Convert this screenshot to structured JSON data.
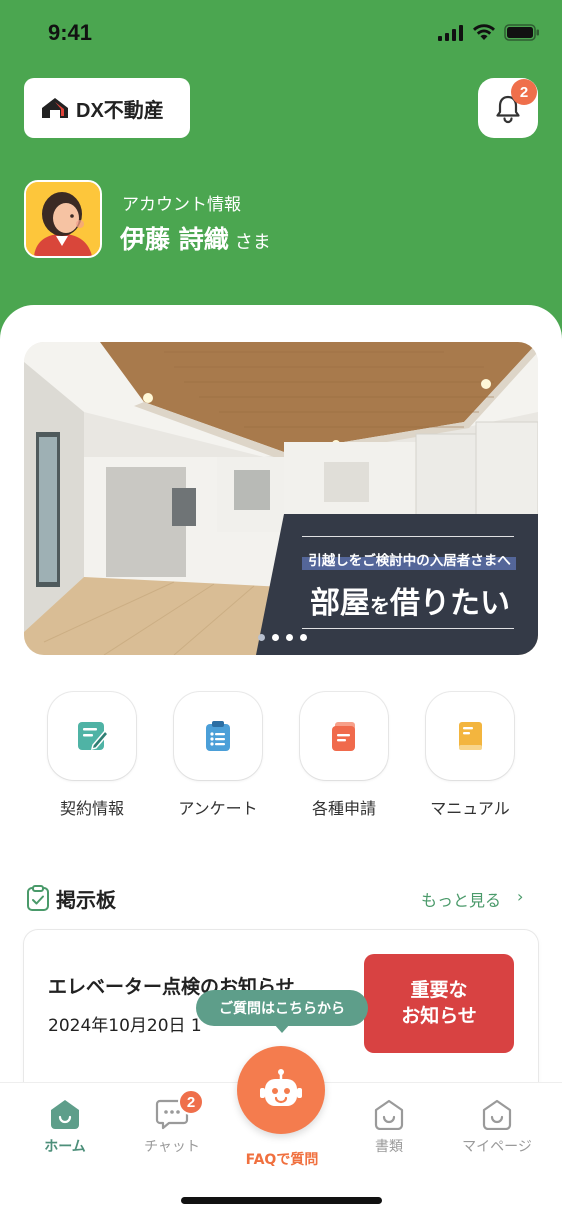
{
  "status_bar": {
    "time": "9:41"
  },
  "header": {
    "logo_text": "DX不動産",
    "notification_count": "2",
    "account_label": "アカウント情報",
    "account_name": "伊藤 詩織",
    "account_suffix": "さま"
  },
  "banner": {
    "subtitle": "引越しをご検討中の入居者さまへ",
    "title_part1": "部屋",
    "title_part2": "を",
    "title_part3": "借りたい",
    "slide_count": 4,
    "active_slide_index": 0
  },
  "menu": [
    {
      "label": "契約情報",
      "icon": "contract-icon",
      "color": "#4fb3a5"
    },
    {
      "label": "アンケート",
      "icon": "clipboard-icon",
      "color": "#4b9fd8"
    },
    {
      "label": "各種申請",
      "icon": "form-icon",
      "color": "#f06a4c"
    },
    {
      "label": "マニュアル",
      "icon": "book-icon",
      "color": "#f3b53e"
    }
  ],
  "bulletin": {
    "title": "掲示板",
    "more_label": "もっと見る",
    "post_title": "エレベーター点検のお知らせ",
    "post_date": "2024年10月20日 1",
    "important_line1": "重要な",
    "important_line2": "お知らせ"
  },
  "faq": {
    "bubble_text": "ご質問はこちらから",
    "button_label": "FAQで質問"
  },
  "tabbar": {
    "home": "ホーム",
    "chat": "チャット",
    "chat_badge": "2",
    "documents": "書類",
    "mypage": "マイページ"
  },
  "colors": {
    "header_green": "#4ba650",
    "accent_orange": "#f47c4e",
    "important_red": "#d84242",
    "tab_active": "#4d8f7a"
  }
}
